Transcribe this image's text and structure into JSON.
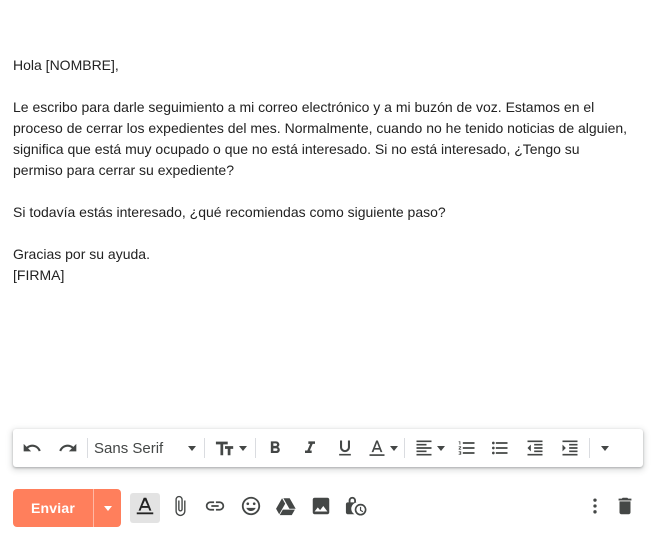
{
  "email": {
    "greeting": "Hola [NOMBRE],",
    "paragraph1": "Le escribo para darle seguimiento a mi correo electrónico y a mi buzón de voz. Estamos en el proceso de cerrar los expedientes del mes. Normalmente, cuando no he tenido noticias de alguien, significa que está muy ocupado o que no está interesado. Si no está interesado, ¿Tengo su permiso para cerrar su expediente?",
    "paragraph2": "Si todavía estás interesado, ¿qué recomiendas como siguiente paso?",
    "closing": "Gracias por su ayuda.",
    "signature": "[FIRMA]"
  },
  "toolbar": {
    "font_name": "Sans Serif",
    "icons": [
      "undo-icon",
      "redo-icon",
      "font-size-icon",
      "bold-icon",
      "italic-icon",
      "underline-icon",
      "text-color-icon",
      "align-icon",
      "numbered-list-icon",
      "bulleted-list-icon",
      "indent-less-icon",
      "indent-more-icon",
      "more-formatting-icon"
    ]
  },
  "bottom_bar": {
    "send_label": "Enviar",
    "accent_color": "#ff7f5c",
    "icons": [
      "formatting-options-icon",
      "attach-icon",
      "link-icon",
      "emoji-icon",
      "drive-icon",
      "photo-icon",
      "confidential-mode-icon",
      "more-options-icon",
      "discard-icon"
    ]
  }
}
